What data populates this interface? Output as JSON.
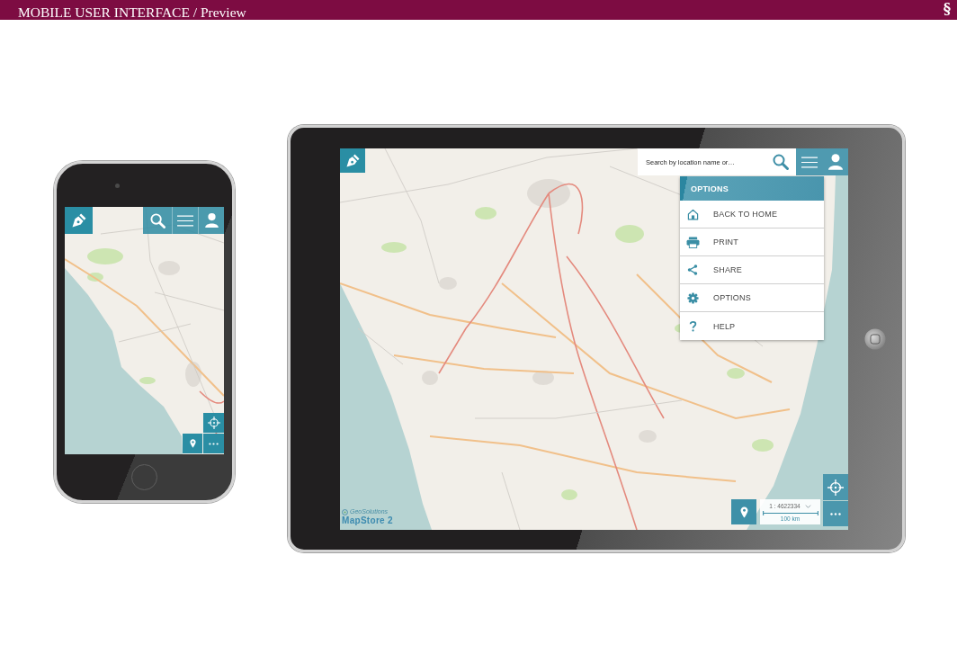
{
  "header": {
    "title": "MOBILE USER INTERFACE / Preview",
    "logo": "§"
  },
  "devices": [
    {
      "kind": "phone"
    },
    {
      "kind": "tablet",
      "search": {
        "placeholder": "Search by location name or…"
      },
      "menu": {
        "title": "OPTIONS",
        "items": [
          {
            "label": "BACK TO HOME"
          },
          {
            "label": "PRINT"
          },
          {
            "label": "SHARE"
          },
          {
            "label": "OPTIONS"
          },
          {
            "label": "HELP"
          }
        ]
      },
      "scale": {
        "value": "1 : 4622334",
        "bar_label": "100 km"
      },
      "logo": {
        "company": "GeoSolutions",
        "product": "MapStore 2"
      }
    }
  ]
}
